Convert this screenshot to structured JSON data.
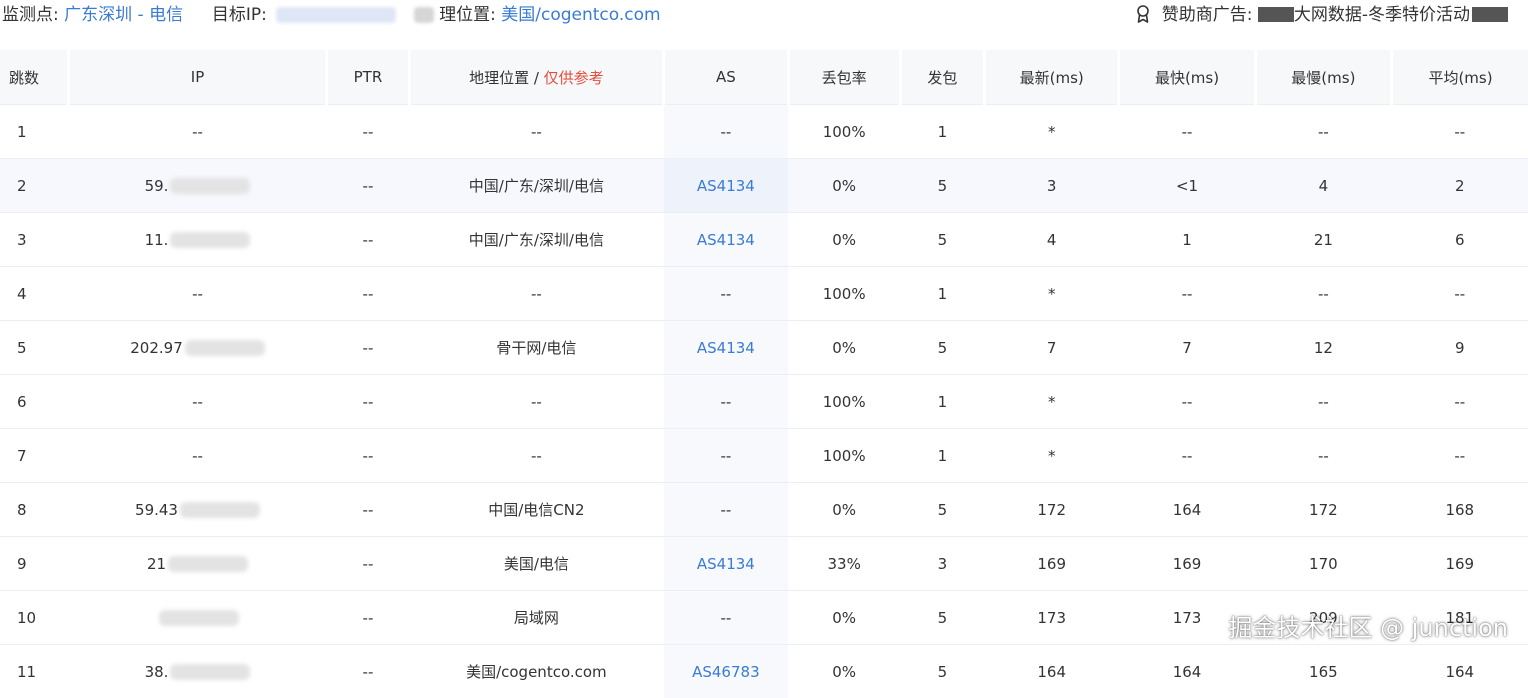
{
  "header": {
    "monitor_label": "监测点:",
    "monitor_value": "广东深圳 - 电信",
    "target_label": "目标IP:",
    "geo_label": "理位置:",
    "geo_value": "美国/cogentco.com",
    "sponsor_label": "赞助商广告:",
    "sponsor_text": "大网数据-冬季特价活动",
    "sponsor_icon": "award-ribbon-icon"
  },
  "table": {
    "columns": [
      "跳数",
      "IP",
      "PTR",
      "地理位置",
      "AS",
      "丢包率",
      "发包",
      "最新(ms)",
      "最快(ms)",
      "最慢(ms)",
      "平均(ms)"
    ],
    "geo_header_sep": " / ",
    "geo_header_note": "仅供参考",
    "rows": [
      {
        "hop": "1",
        "ip": "--",
        "ptr": "--",
        "geo": "--",
        "as": "--",
        "loss": "100%",
        "sent": "1",
        "last": "*",
        "best": "--",
        "worst": "--",
        "avg": "--"
      },
      {
        "hop": "2",
        "ip": "59.",
        "ptr": "--",
        "geo": "中国/广东/深圳/电信",
        "as": "AS4134",
        "loss": "0%",
        "sent": "5",
        "last": "3",
        "best": "<1",
        "worst": "4",
        "avg": "2"
      },
      {
        "hop": "3",
        "ip": "11.",
        "ptr": "--",
        "geo": "中国/广东/深圳/电信",
        "as": "AS4134",
        "loss": "0%",
        "sent": "5",
        "last": "4",
        "best": "1",
        "worst": "21",
        "avg": "6"
      },
      {
        "hop": "4",
        "ip": "--",
        "ptr": "--",
        "geo": "--",
        "as": "--",
        "loss": "100%",
        "sent": "1",
        "last": "*",
        "best": "--",
        "worst": "--",
        "avg": "--"
      },
      {
        "hop": "5",
        "ip": "202.97",
        "ptr": "--",
        "geo": "骨干网/电信",
        "as": "AS4134",
        "loss": "0%",
        "sent": "5",
        "last": "7",
        "best": "7",
        "worst": "12",
        "avg": "9"
      },
      {
        "hop": "6",
        "ip": "--",
        "ptr": "--",
        "geo": "--",
        "as": "--",
        "loss": "100%",
        "sent": "1",
        "last": "*",
        "best": "--",
        "worst": "--",
        "avg": "--"
      },
      {
        "hop": "7",
        "ip": "--",
        "ptr": "--",
        "geo": "--",
        "as": "--",
        "loss": "100%",
        "sent": "1",
        "last": "*",
        "best": "--",
        "worst": "--",
        "avg": "--"
      },
      {
        "hop": "8",
        "ip": "59.43",
        "ptr": "--",
        "geo": "中国/电信CN2",
        "as": "--",
        "loss": "0%",
        "sent": "5",
        "last": "172",
        "best": "164",
        "worst": "172",
        "avg": "168"
      },
      {
        "hop": "9",
        "ip": "21",
        "ptr": "--",
        "geo": "美国/电信",
        "as": "AS4134",
        "loss": "33%",
        "sent": "3",
        "last": "169",
        "best": "169",
        "worst": "170",
        "avg": "169"
      },
      {
        "hop": "10",
        "ip": "",
        "ptr": "--",
        "geo": "局域网",
        "as": "--",
        "loss": "0%",
        "sent": "5",
        "last": "173",
        "best": "173",
        "worst": "209",
        "avg": "181"
      },
      {
        "hop": "11",
        "ip": "38.",
        "ptr": "--",
        "geo": "美国/cogentco.com",
        "as": "AS46783",
        "loss": "0%",
        "sent": "5",
        "last": "164",
        "best": "164",
        "worst": "165",
        "avg": "164"
      }
    ]
  },
  "watermark": "掘金技术社区 @ junction",
  "colors": {
    "link": "#3a7bd5",
    "note_red": "#e84d3d",
    "header_bg": "#f7f8fa",
    "highlight_row": "#f6f8fd"
  }
}
